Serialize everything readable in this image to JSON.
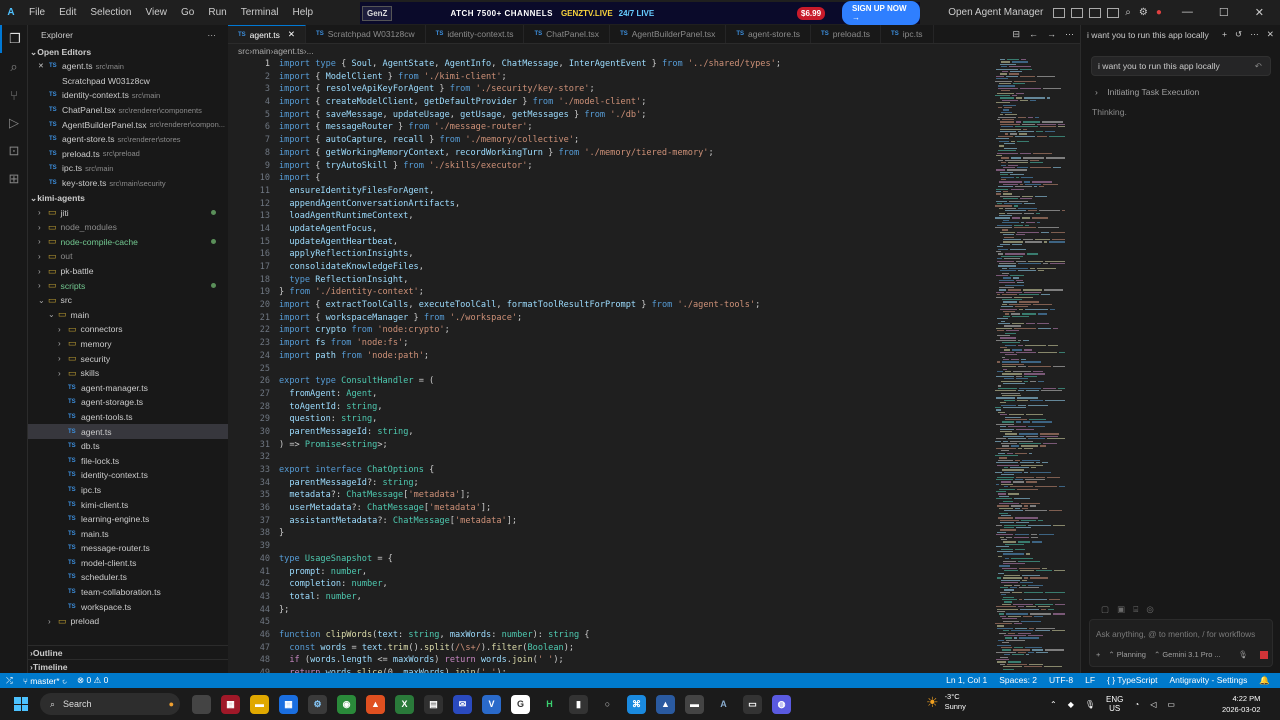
{
  "menu": [
    "File",
    "Edit",
    "Selection",
    "View",
    "Go",
    "Run",
    "Terminal",
    "Help"
  ],
  "ad": {
    "logo": "GenZ",
    "text": "ATCH 7500+ CHANNELS",
    "brand": "GENZTV.LIVE",
    "sub": "24/7 LIVE",
    "price": "$6.99",
    "cta": "SIGN UP NOW →"
  },
  "title_right": {
    "app": "Open Agent Manager"
  },
  "explorer": {
    "title": "Explorer",
    "open_editors_label": "Open Editors",
    "open_editors": [
      {
        "name": "agent.ts",
        "path": "src\\main",
        "icon": "TS",
        "closeable": true
      },
      {
        "name": "Scratchpad W031z8cw",
        "path": "",
        "icon": ""
      },
      {
        "name": "identity-context.ts",
        "path": "src\\main",
        "icon": "TS"
      },
      {
        "name": "ChatPanel.tsx",
        "path": "src\\renderer\\components",
        "icon": "TS"
      },
      {
        "name": "AgentBuilderPanel.tsx",
        "path": "src\\renderer\\compon...",
        "icon": "TS"
      },
      {
        "name": "agent-store.ts",
        "path": "src\\renderer\\stores",
        "icon": "TS"
      },
      {
        "name": "preload.ts",
        "path": "src\\preload",
        "icon": "TS"
      },
      {
        "name": "ipc.ts",
        "path": "src\\main",
        "icon": "TS"
      },
      {
        "name": "key-store.ts",
        "path": "src\\main\\security",
        "icon": "TS"
      }
    ],
    "project_label": "kimi-agents",
    "tree": [
      {
        "name": "jiti",
        "type": "folder",
        "depth": 1,
        "dot": true
      },
      {
        "name": "node_modules",
        "type": "folder",
        "depth": 1,
        "muted": true
      },
      {
        "name": "node-compile-cache",
        "type": "folder",
        "depth": 1,
        "green": true,
        "dot": true
      },
      {
        "name": "out",
        "type": "folder",
        "depth": 1,
        "muted": true
      },
      {
        "name": "pk-battle",
        "type": "folder",
        "depth": 1
      },
      {
        "name": "scripts",
        "type": "folder",
        "depth": 1,
        "green": true,
        "dot": true
      },
      {
        "name": "src",
        "type": "folder",
        "depth": 1,
        "open": true
      },
      {
        "name": "main",
        "type": "folder",
        "depth": 2,
        "open": true
      },
      {
        "name": "connectors",
        "type": "folder",
        "depth": 3
      },
      {
        "name": "memory",
        "type": "folder",
        "depth": 3
      },
      {
        "name": "security",
        "type": "folder",
        "depth": 3
      },
      {
        "name": "skills",
        "type": "folder",
        "depth": 3
      },
      {
        "name": "agent-manager.ts",
        "type": "file",
        "depth": 3
      },
      {
        "name": "agent-storage.ts",
        "type": "file",
        "depth": 3
      },
      {
        "name": "agent-tools.ts",
        "type": "file",
        "depth": 3
      },
      {
        "name": "agent.ts",
        "type": "file",
        "depth": 3,
        "selected": true
      },
      {
        "name": "db.ts",
        "type": "file",
        "depth": 3
      },
      {
        "name": "file-lock.ts",
        "type": "file",
        "depth": 3
      },
      {
        "name": "identity-context.ts",
        "type": "file",
        "depth": 3
      },
      {
        "name": "ipc.ts",
        "type": "file",
        "depth": 3
      },
      {
        "name": "kimi-client.ts",
        "type": "file",
        "depth": 3
      },
      {
        "name": "learning-engine.ts",
        "type": "file",
        "depth": 3
      },
      {
        "name": "main.ts",
        "type": "file",
        "depth": 3
      },
      {
        "name": "message-router.ts",
        "type": "file",
        "depth": 3
      },
      {
        "name": "model-client.ts",
        "type": "file",
        "depth": 3
      },
      {
        "name": "scheduler.ts",
        "type": "file",
        "depth": 3
      },
      {
        "name": "team-collaboration.ts",
        "type": "file",
        "depth": 3
      },
      {
        "name": "workspace.ts",
        "type": "file",
        "depth": 3
      },
      {
        "name": "preload",
        "type": "folder",
        "depth": 2
      }
    ],
    "outline": "Outline",
    "timeline": "Timeline"
  },
  "tabs": [
    {
      "name": "agent.ts",
      "active": true
    },
    {
      "name": "Scratchpad W031z8cw"
    },
    {
      "name": "identity-context.ts"
    },
    {
      "name": "ChatPanel.tsx"
    },
    {
      "name": "AgentBuilderPanel.tsx"
    },
    {
      "name": "agent-store.ts"
    },
    {
      "name": "preload.ts"
    },
    {
      "name": "ipc.ts"
    }
  ],
  "breadcrumb": [
    "src",
    "main",
    "agent.ts",
    "..."
  ],
  "code": [
    [
      [
        "k",
        "import type "
      ],
      [
        "",
        "{ "
      ],
      [
        "v",
        "Soul"
      ],
      [
        "",
        ", "
      ],
      [
        "v",
        "AgentState"
      ],
      [
        "",
        ", "
      ],
      [
        "v",
        "AgentInfo"
      ],
      [
        "",
        ", "
      ],
      [
        "v",
        "ChatMessage"
      ],
      [
        "",
        ", "
      ],
      [
        "v",
        "InterAgentEvent"
      ],
      [
        "",
        " } "
      ],
      [
        "k",
        "from "
      ],
      [
        "s",
        "'../shared/types'"
      ],
      [
        "",
        ";"
      ]
    ],
    [
      [
        "k",
        "import "
      ],
      [
        "",
        "{ "
      ],
      [
        "v",
        "ModelClient"
      ],
      [
        "",
        " } "
      ],
      [
        "k",
        "from "
      ],
      [
        "s",
        "'./kimi-client'"
      ],
      [
        "",
        ";"
      ]
    ],
    [
      [
        "k",
        "import "
      ],
      [
        "",
        "{ "
      ],
      [
        "v",
        "resolveApiKeyForAgent"
      ],
      [
        "",
        " } "
      ],
      [
        "k",
        "from "
      ],
      [
        "s",
        "'./security/key-store'"
      ],
      [
        "",
        ";"
      ]
    ],
    [
      [
        "k",
        "import "
      ],
      [
        "",
        "{ "
      ],
      [
        "v",
        "createModelClient"
      ],
      [
        "",
        ", "
      ],
      [
        "v",
        "getDefaultProvider"
      ],
      [
        "",
        " } "
      ],
      [
        "k",
        "from "
      ],
      [
        "s",
        "'./model-client'"
      ],
      [
        "",
        ";"
      ]
    ],
    [
      [
        "k",
        "import "
      ],
      [
        "",
        "{ "
      ],
      [
        "v",
        "saveMessage"
      ],
      [
        "",
        ", "
      ],
      [
        "v",
        "updateUsage"
      ],
      [
        "",
        ", "
      ],
      [
        "v",
        "getUsage"
      ],
      [
        "",
        ", "
      ],
      [
        "v",
        "getMessages"
      ],
      [
        "",
        " } "
      ],
      [
        "k",
        "from "
      ],
      [
        "s",
        "'./db'"
      ],
      [
        "",
        ";"
      ]
    ],
    [
      [
        "k",
        "import "
      ],
      [
        "",
        "{ "
      ],
      [
        "v",
        "messageRouter"
      ],
      [
        "",
        " } "
      ],
      [
        "k",
        "from "
      ],
      [
        "s",
        "'./message-router'"
      ],
      [
        "",
        ";"
      ]
    ],
    [
      [
        "k",
        "import "
      ],
      [
        "",
        "{ "
      ],
      [
        "v",
        "autoCapture"
      ],
      [
        "",
        ", "
      ],
      [
        "v",
        "recall"
      ],
      [
        "",
        " } "
      ],
      [
        "k",
        "from "
      ],
      [
        "s",
        "'./memory/collective'"
      ],
      [
        "",
        ";"
      ]
    ],
    [
      [
        "k",
        "import "
      ],
      [
        "",
        "{ "
      ],
      [
        "v",
        "getWorkingMemoryContext"
      ],
      [
        "",
        ", "
      ],
      [
        "v",
        "recordWorkingTurn"
      ],
      [
        "",
        " } "
      ],
      [
        "k",
        "from "
      ],
      [
        "s",
        "'./memory/tiered-memory'"
      ],
      [
        "",
        ";"
      ]
    ],
    [
      [
        "k",
        "import "
      ],
      [
        "",
        "{ "
      ],
      [
        "v",
        "tryAutoSkill"
      ],
      [
        "",
        " } "
      ],
      [
        "k",
        "from "
      ],
      [
        "s",
        "'./skills/executor'"
      ],
      [
        "",
        ";"
      ]
    ],
    [
      [
        "k",
        "import "
      ],
      [
        "",
        "{"
      ]
    ],
    [
      [
        "",
        "  "
      ],
      [
        "v",
        "ensureIdentityFilesForAgent"
      ],
      [
        "",
        ","
      ]
    ],
    [
      [
        "",
        "  "
      ],
      [
        "v",
        "appendAgentConversationArtifacts"
      ],
      [
        "",
        ","
      ]
    ],
    [
      [
        "",
        "  "
      ],
      [
        "v",
        "loadAgentRuntimeContext"
      ],
      [
        "",
        ","
      ]
    ],
    [
      [
        "",
        "  "
      ],
      [
        "v",
        "updateAgentFocus"
      ],
      [
        "",
        ","
      ]
    ],
    [
      [
        "",
        "  "
      ],
      [
        "v",
        "updateAgentHeartbeat"
      ],
      [
        "",
        ","
      ]
    ],
    [
      [
        "",
        "  "
      ],
      [
        "v",
        "applyReflectionInsights"
      ],
      [
        "",
        ","
      ]
    ],
    [
      [
        "",
        "  "
      ],
      [
        "v",
        "consolidateKnowledgeFiles"
      ],
      [
        "",
        ","
      ]
    ],
    [
      [
        "",
        "  "
      ],
      [
        "k",
        "type "
      ],
      [
        "v",
        "ReflectionInsight"
      ],
      [
        "",
        ","
      ]
    ],
    [
      [
        "",
        "} "
      ],
      [
        "k",
        "from "
      ],
      [
        "s",
        "'./identity-context'"
      ],
      [
        "",
        ";"
      ]
    ],
    [
      [
        "k",
        "import "
      ],
      [
        "",
        "{ "
      ],
      [
        "v",
        "extractToolCalls"
      ],
      [
        "",
        ", "
      ],
      [
        "v",
        "executeToolCall"
      ],
      [
        "",
        ", "
      ],
      [
        "v",
        "formatToolResultForPrompt"
      ],
      [
        "",
        " } "
      ],
      [
        "k",
        "from "
      ],
      [
        "s",
        "'./agent-tools'"
      ],
      [
        "",
        ";"
      ]
    ],
    [
      [
        "k",
        "import "
      ],
      [
        "",
        "{ "
      ],
      [
        "v",
        "workspaceManager"
      ],
      [
        "",
        " } "
      ],
      [
        "k",
        "from "
      ],
      [
        "s",
        "'./workspace'"
      ],
      [
        "",
        ";"
      ]
    ],
    [
      [
        "k",
        "import "
      ],
      [
        "v",
        "crypto "
      ],
      [
        "k",
        "from "
      ],
      [
        "s",
        "'node:crypto'"
      ],
      [
        "",
        ";"
      ]
    ],
    [
      [
        "k",
        "import "
      ],
      [
        "v",
        "fs "
      ],
      [
        "k",
        "from "
      ],
      [
        "s",
        "'node:fs'"
      ],
      [
        "",
        ";"
      ]
    ],
    [
      [
        "k",
        "import "
      ],
      [
        "v",
        "path "
      ],
      [
        "k",
        "from "
      ],
      [
        "s",
        "'node:path'"
      ],
      [
        "",
        ";"
      ]
    ],
    [],
    [
      [
        "k",
        "export type "
      ],
      [
        "t",
        "ConsultHandler"
      ],
      [
        "",
        " = ("
      ]
    ],
    [
      [
        "",
        "  "
      ],
      [
        "v",
        "fromAgent"
      ],
      [
        "",
        ": "
      ],
      [
        "t",
        "Agent"
      ],
      [
        "",
        ","
      ]
    ],
    [
      [
        "",
        "  "
      ],
      [
        "v",
        "toAgentId"
      ],
      [
        "",
        ": "
      ],
      [
        "t",
        "string"
      ],
      [
        "",
        ","
      ]
    ],
    [
      [
        "",
        "  "
      ],
      [
        "v",
        "question"
      ],
      [
        "",
        ": "
      ],
      [
        "t",
        "string"
      ],
      [
        "",
        ","
      ]
    ],
    [
      [
        "",
        "  "
      ],
      [
        "v",
        "parentMessageId"
      ],
      [
        "",
        ": "
      ],
      [
        "t",
        "string"
      ],
      [
        "",
        ","
      ]
    ],
    [
      [
        "",
        ") => "
      ],
      [
        "t",
        "Promise"
      ],
      [
        "",
        "<"
      ],
      [
        "t",
        "string"
      ],
      [
        "",
        ">;"
      ]
    ],
    [],
    [
      [
        "k",
        "export interface "
      ],
      [
        "t",
        "ChatOptions "
      ],
      [
        "",
        "{"
      ]
    ],
    [
      [
        "",
        "  "
      ],
      [
        "v",
        "parentMessageId"
      ],
      [
        "",
        "?: "
      ],
      [
        "t",
        "string"
      ],
      [
        "",
        ";"
      ]
    ],
    [
      [
        "",
        "  "
      ],
      [
        "v",
        "metadata"
      ],
      [
        "",
        "?: "
      ],
      [
        "t",
        "ChatMessage"
      ],
      [
        "",
        "["
      ],
      [
        "s",
        "'metadata'"
      ],
      [
        "",
        "];"
      ]
    ],
    [
      [
        "",
        "  "
      ],
      [
        "v",
        "userMetadata"
      ],
      [
        "",
        "?: "
      ],
      [
        "t",
        "ChatMessage"
      ],
      [
        "",
        "["
      ],
      [
        "s",
        "'metadata'"
      ],
      [
        "",
        "];"
      ]
    ],
    [
      [
        "",
        "  "
      ],
      [
        "v",
        "assistantMetadata"
      ],
      [
        "",
        "?: "
      ],
      [
        "t",
        "ChatMessage"
      ],
      [
        "",
        "["
      ],
      [
        "s",
        "'metadata'"
      ],
      [
        "",
        "];"
      ]
    ],
    [
      [
        "",
        "}"
      ]
    ],
    [],
    [
      [
        "k",
        "type "
      ],
      [
        "t",
        "UsageSnapshot"
      ],
      [
        "",
        " = {"
      ]
    ],
    [
      [
        "",
        "  "
      ],
      [
        "v",
        "prompt"
      ],
      [
        "",
        ": "
      ],
      [
        "t",
        "number"
      ],
      [
        "",
        ","
      ]
    ],
    [
      [
        "",
        "  "
      ],
      [
        "v",
        "completion"
      ],
      [
        "",
        ": "
      ],
      [
        "t",
        "number"
      ],
      [
        "",
        ","
      ]
    ],
    [
      [
        "",
        "  "
      ],
      [
        "v",
        "total"
      ],
      [
        "",
        ": "
      ],
      [
        "t",
        "number"
      ],
      [
        "",
        ","
      ]
    ],
    [
      [
        "",
        "};"
      ]
    ],
    [],
    [
      [
        "k",
        "function "
      ],
      [
        "f",
        "clipWords"
      ],
      [
        "",
        "("
      ],
      [
        "v",
        "text"
      ],
      [
        "",
        ": "
      ],
      [
        "t",
        "string"
      ],
      [
        "",
        ", "
      ],
      [
        "v",
        "maxWords"
      ],
      [
        "",
        ": "
      ],
      [
        "t",
        "number"
      ],
      [
        "",
        "): "
      ],
      [
        "t",
        "string"
      ],
      [
        "",
        " {"
      ]
    ],
    [
      [
        "",
        "  "
      ],
      [
        "k",
        "const "
      ],
      [
        "v",
        "words"
      ],
      [
        "",
        " = "
      ],
      [
        "v",
        "text"
      ],
      [
        "",
        "."
      ],
      [
        "f",
        "trim"
      ],
      [
        "",
        "()."
      ],
      [
        "f",
        "split"
      ],
      [
        "",
        "("
      ],
      [
        "s",
        "/\\s+/"
      ],
      [
        "",
        ")."
      ],
      [
        "f",
        "filter"
      ],
      [
        "",
        "("
      ],
      [
        "t",
        "Boolean"
      ],
      [
        "",
        ");"
      ]
    ],
    [
      [
        "",
        "  "
      ],
      [
        "kc",
        "if "
      ],
      [
        "",
        "("
      ],
      [
        "v",
        "words"
      ],
      [
        "",
        "."
      ],
      [
        "v",
        "length"
      ],
      [
        "",
        " <= "
      ],
      [
        "v",
        "maxWords"
      ],
      [
        "",
        ") "
      ],
      [
        "kc",
        "return "
      ],
      [
        "v",
        "words"
      ],
      [
        "",
        "."
      ],
      [
        "f",
        "join"
      ],
      [
        "",
        "("
      ],
      [
        "s",
        "' '"
      ],
      [
        "",
        ");"
      ]
    ],
    [
      [
        "",
        "  "
      ],
      [
        "kc",
        "return "
      ],
      [
        "v",
        "words"
      ],
      [
        "",
        "."
      ],
      [
        "f",
        "slice"
      ],
      [
        "",
        "(0, "
      ],
      [
        "v",
        "maxWords"
      ],
      [
        "",
        ")."
      ],
      [
        "f",
        "join"
      ],
      [
        "",
        "("
      ],
      [
        "s",
        "' '"
      ],
      [
        "",
        ");"
      ]
    ]
  ],
  "chat": {
    "header": "i want you to run this app locally",
    "message": "i want you to run this app locally",
    "step": "Initiating Task Execution",
    "thinking": "Thinking.",
    "placeholder": "Ask anything, @ to mention, / for workflows",
    "mode": "Planning",
    "model": "Gemini 3.1 Pro ..."
  },
  "status": {
    "branch": "master*",
    "problems": "⊗ 0 ⚠ 0",
    "position": "Ln 1, Col 1",
    "spaces": "Spaces: 2",
    "encoding": "UTF-8",
    "eol": "LF",
    "language": "TypeScript",
    "settings": "Antigravity - Settings"
  },
  "taskbar": {
    "search": "Search",
    "temp": "-3°C",
    "weather": "Sunny",
    "lang": "ENG",
    "region": "US",
    "time": "4:22 PM",
    "date": "2026-03-02"
  },
  "colors": {
    "accent": "#007acc",
    "editor_bg": "#1f1f1f",
    "keyword": "#569cd6",
    "string": "#ce9178",
    "type": "#4ec9b0"
  }
}
